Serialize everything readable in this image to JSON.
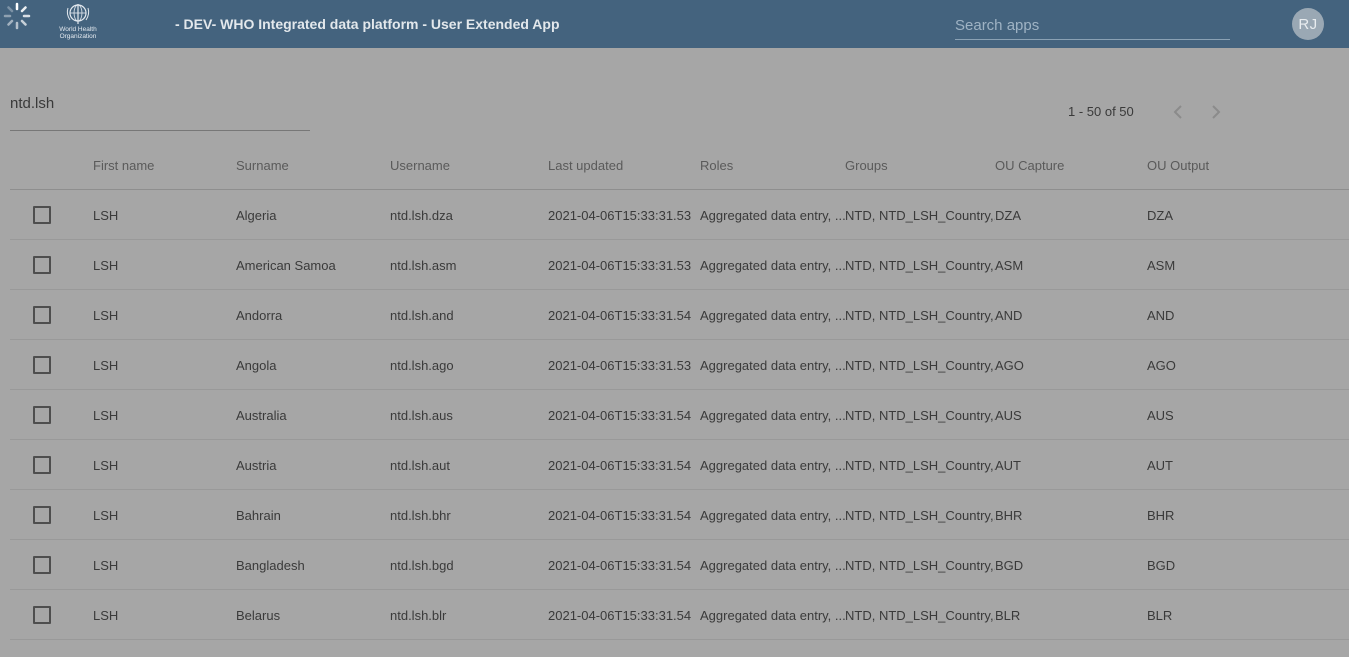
{
  "header": {
    "logo_text_line1": "World Health",
    "logo_text_line2": "Organization",
    "title": "- DEV- WHO Integrated data platform - User Extended App",
    "search_placeholder": "Search apps",
    "avatar_initials": "RJ",
    "loading_icon": "spinner-icon",
    "logo_icon": "who-emblem-icon"
  },
  "filter": {
    "value": "ntd.lsh"
  },
  "pagination": {
    "label": "1 - 50 of 50",
    "prev_icon": "chevron-left-icon",
    "next_icon": "chevron-right-icon"
  },
  "table": {
    "columns": [
      "First name",
      "Surname",
      "Username",
      "Last updated",
      "Roles",
      "Groups",
      "OU Capture",
      "OU Output"
    ],
    "rows": [
      {
        "first": "LSH",
        "surname": "Algeria",
        "username": "ntd.lsh.dza",
        "updated": "2021-04-06T15:33:31.53",
        "roles": "Aggregated data entry, ...",
        "groups": "NTD, NTD_LSH_Country,...",
        "ou_capture": "DZA",
        "ou_output": "DZA"
      },
      {
        "first": "LSH",
        "surname": "American Samoa",
        "username": "ntd.lsh.asm",
        "updated": "2021-04-06T15:33:31.53",
        "roles": "Aggregated data entry, ...",
        "groups": "NTD, NTD_LSH_Country,...",
        "ou_capture": "ASM",
        "ou_output": "ASM"
      },
      {
        "first": "LSH",
        "surname": "Andorra",
        "username": "ntd.lsh.and",
        "updated": "2021-04-06T15:33:31.54",
        "roles": "Aggregated data entry, ...",
        "groups": "NTD, NTD_LSH_Country,...",
        "ou_capture": "AND",
        "ou_output": "AND"
      },
      {
        "first": "LSH",
        "surname": "Angola",
        "username": "ntd.lsh.ago",
        "updated": "2021-04-06T15:33:31.53",
        "roles": "Aggregated data entry, ...",
        "groups": "NTD, NTD_LSH_Country,...",
        "ou_capture": "AGO",
        "ou_output": "AGO"
      },
      {
        "first": "LSH",
        "surname": "Australia",
        "username": "ntd.lsh.aus",
        "updated": "2021-04-06T15:33:31.54",
        "roles": "Aggregated data entry, ...",
        "groups": "NTD, NTD_LSH_Country,...",
        "ou_capture": "AUS",
        "ou_output": "AUS"
      },
      {
        "first": "LSH",
        "surname": "Austria",
        "username": "ntd.lsh.aut",
        "updated": "2021-04-06T15:33:31.54",
        "roles": "Aggregated data entry, ...",
        "groups": "NTD, NTD_LSH_Country,...",
        "ou_capture": "AUT",
        "ou_output": "AUT"
      },
      {
        "first": "LSH",
        "surname": "Bahrain",
        "username": "ntd.lsh.bhr",
        "updated": "2021-04-06T15:33:31.54",
        "roles": "Aggregated data entry, ...",
        "groups": "NTD, NTD_LSH_Country,...",
        "ou_capture": "BHR",
        "ou_output": "BHR"
      },
      {
        "first": "LSH",
        "surname": "Bangladesh",
        "username": "ntd.lsh.bgd",
        "updated": "2021-04-06T15:33:31.54",
        "roles": "Aggregated data entry, ...",
        "groups": "NTD, NTD_LSH_Country,...",
        "ou_capture": "BGD",
        "ou_output": "BGD"
      },
      {
        "first": "LSH",
        "surname": "Belarus",
        "username": "ntd.lsh.blr",
        "updated": "2021-04-06T15:33:31.54",
        "roles": "Aggregated data entry, ...",
        "groups": "NTD, NTD_LSH_Country,...",
        "ou_capture": "BLR",
        "ou_output": "BLR"
      }
    ]
  },
  "colors": {
    "header_bg": "#44637e",
    "overlay_bg": "#a6a6a6"
  }
}
